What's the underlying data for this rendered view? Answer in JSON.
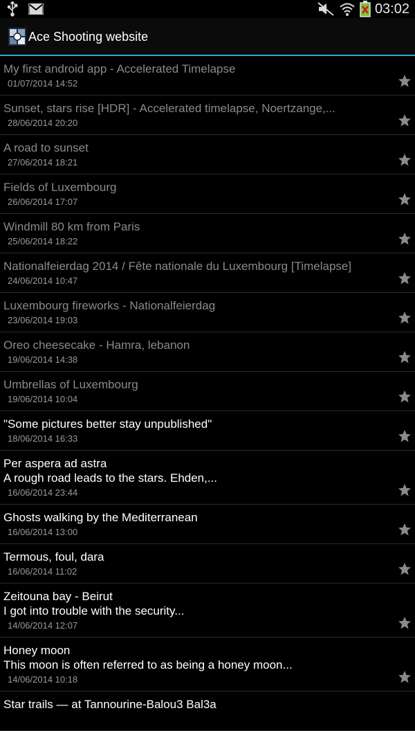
{
  "status_bar": {
    "time": "03:02",
    "left_icons": [
      "usb-icon",
      "gmail-icon"
    ],
    "right_icons": [
      "mute-icon",
      "wifi-icon",
      "battery-icon"
    ]
  },
  "app": {
    "title": "Ace Shooting website"
  },
  "colors": {
    "accent": "#33a6d8",
    "read_title": "#8a8a8a",
    "unread_title": "#ffffff",
    "date": "#9a9a9a"
  },
  "items": [
    {
      "title": "My first android app - Accelerated Timelapse",
      "date": "01/07/2014 14:52",
      "read": true
    },
    {
      "title": "Sunset, stars rise [HDR] - Accelerated timelapse, Noertzange,...",
      "date": "28/06/2014 20:20",
      "read": true
    },
    {
      "title": "A road to sunset",
      "date": "27/06/2014 18:21",
      "read": true
    },
    {
      "title": "Fields of Luxembourg",
      "date": "26/06/2014 17:07",
      "read": true
    },
    {
      "title": "Windmill 80 km from Paris",
      "date": "25/06/2014 18:22",
      "read": true
    },
    {
      "title": "Nationalfeierdag 2014 / Fête nationale du Luxembourg [Timelapse]",
      "date": "24/06/2014 10:47",
      "read": true
    },
    {
      "title": "Luxembourg fireworks - Nationalfeierdag",
      "date": "23/06/2014 19:03",
      "read": true
    },
    {
      "title": "Oreo cheesecake - Hamra, lebanon",
      "date": "19/06/2014 14:38",
      "read": true
    },
    {
      "title": "Umbrellas of Luxembourg",
      "date": "19/06/2014 10:04",
      "read": true
    },
    {
      "title": "\"Some pictures better stay unpublished\"",
      "date": "18/06/2014 16:33",
      "read": false
    },
    {
      "title": "Per aspera ad astra",
      "subtitle": "A rough road leads to the stars. Ehden,...",
      "date": "16/06/2014 23:44",
      "read": false
    },
    {
      "title": "Ghosts walking by the Mediterranean",
      "date": "16/06/2014 13:00",
      "read": false
    },
    {
      "title": "Termous, foul, dara",
      "date": "16/06/2014 11:02",
      "read": false
    },
    {
      "title": "Zeitouna bay - Beirut",
      "subtitle": "I got into trouble with the security...",
      "date": "14/06/2014 12:07",
      "read": false
    },
    {
      "title": "Honey moon",
      "subtitle": "This moon is often referred to as being a honey moon...",
      "date": "14/06/2014 10:18",
      "read": false
    },
    {
      "title": "Star trails — at Tannourine-Balou3 Bal3a",
      "date": "",
      "read": false
    }
  ]
}
